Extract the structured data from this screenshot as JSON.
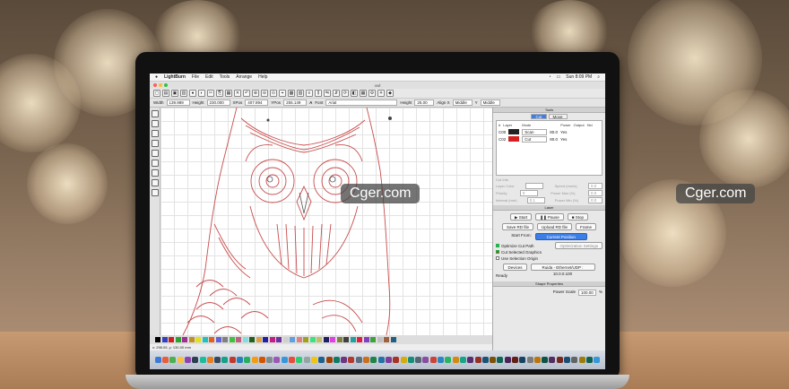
{
  "menubar": {
    "app": "LightBurn",
    "items": [
      "File",
      "Edit",
      "Tools",
      "Arrange",
      "Help"
    ],
    "clock": "Sun 8:09 PM"
  },
  "window": {
    "title": "owl"
  },
  "props": {
    "width_label": "Width",
    "width_val": "139.989",
    "height_label": "Height",
    "height_val": "230.000",
    "xpos_label": "XPos",
    "xpos_val": "407.894",
    "ypos_label": "YPos",
    "ypos_val": "255.149",
    "font_label": "Font",
    "font_val": "Arial",
    "fheight_label": "Height",
    "fheight_val": "25.00",
    "alignx_label": "Align X",
    "alignx_val": "Middle",
    "aligny_label": "Y",
    "aligny_val": "Middle"
  },
  "cuts": {
    "header": "Tools",
    "tabs": [
      "Cut",
      "Move"
    ],
    "columns": [
      "#",
      "Layer",
      "Mode",
      "Power",
      "Output",
      "Hid"
    ],
    "rows": [
      {
        "id": "C00",
        "color": "#222222",
        "mode": "Scan",
        "power": "80.0",
        "output": "Yes"
      },
      {
        "id": "C02",
        "color": "#d42020",
        "mode": "Cut",
        "power": "80.0",
        "output": "Yes"
      }
    ]
  },
  "cutinfo": {
    "title": "Cut Info",
    "fields": [
      {
        "l": "Layer Color",
        "v": "",
        "l2": "Speed (mm/s)",
        "v2": "0.0"
      },
      {
        "l": "Priority",
        "v": "0",
        "l2": "Power Max (%)",
        "v2": "0.0"
      },
      {
        "l": "Interval (mm)",
        "v": "0.1",
        "l2": "Power Min (%)",
        "v2": "0.0"
      }
    ]
  },
  "laser": {
    "header": "Laser",
    "start": "Start",
    "pause": "Pause",
    "stop": "Stop",
    "save": "Save RD file",
    "upload": "Upload RD file",
    "frame": "Frame",
    "start_from_label": "Start From:",
    "start_from_val": "Current Position",
    "optimize": "Optimize Cut Path",
    "opt_settings": "Optimization Settings",
    "cut_selected": "Cut Selected Graphics",
    "use_origin": "Use Selection Origin",
    "devices": "Devices",
    "device_val": "Ruida - Ethernet/UDP : 10.0.0.100",
    "ready": "Ready"
  },
  "shape": {
    "header": "Shape Properties",
    "label": "Power Scale",
    "val": "100.00",
    "unit": "%"
  },
  "status_text": "x: 298.05, y: 130.00 mm",
  "palette": [
    "#000",
    "#3040c0",
    "#d02020",
    "#30a030",
    "#a03090",
    "#c09020",
    "#e0e020",
    "#20c0c0",
    "#e06020",
    "#6060e0",
    "#808080",
    "#40c040",
    "#c06080",
    "#80e0e0",
    "#206020",
    "#e0a040",
    "#2020a0",
    "#c02080",
    "#7030a0",
    "#d0d0d0",
    "#60a0e0",
    "#e08080",
    "#a0a020",
    "#40e080",
    "#c0c060",
    "#202060",
    "#e040e0",
    "#808040",
    "#404040",
    "#20a0a0",
    "#e02040",
    "#8040c0",
    "#40a040",
    "#c0c0c0",
    "#a06040",
    "#206080"
  ],
  "dock": [
    "#3a7bd5",
    "#e85d3c",
    "#4caf50",
    "#f5c242",
    "#8e44ad",
    "#2c3e50",
    "#1abc9c",
    "#e67e22",
    "#34495e",
    "#16a085",
    "#c0392b",
    "#2980b9",
    "#27ae60",
    "#f39c12",
    "#d35400",
    "#7f8c8d",
    "#9b59b6",
    "#3498db",
    "#e74c3c",
    "#2ecc71",
    "#95a5a6",
    "#f1c40f",
    "#1f618d",
    "#a04000",
    "#117a65",
    "#6c3483",
    "#b03a2e",
    "#5d6d7e",
    "#ca6f1e",
    "#1e8449",
    "#2471a3",
    "#7d3c98",
    "#a93226",
    "#d4ac0d",
    "#148f77",
    "#566573",
    "#884ea0",
    "#cb4335",
    "#2e86c1",
    "#28b463",
    "#d68910",
    "#17a589",
    "#5b2c6f",
    "#943126",
    "#1a5276",
    "#7e5109",
    "#0e6655",
    "#4a235a",
    "#641e16",
    "#154360",
    "#7b7d7d",
    "#b9770e",
    "#0b5345",
    "#512e5f",
    "#78281f",
    "#1b4f72",
    "#626567",
    "#9a7d0a",
    "#0e6251",
    "#3498db"
  ],
  "watermarks": [
    "Cger.com",
    "Cger.com"
  ]
}
